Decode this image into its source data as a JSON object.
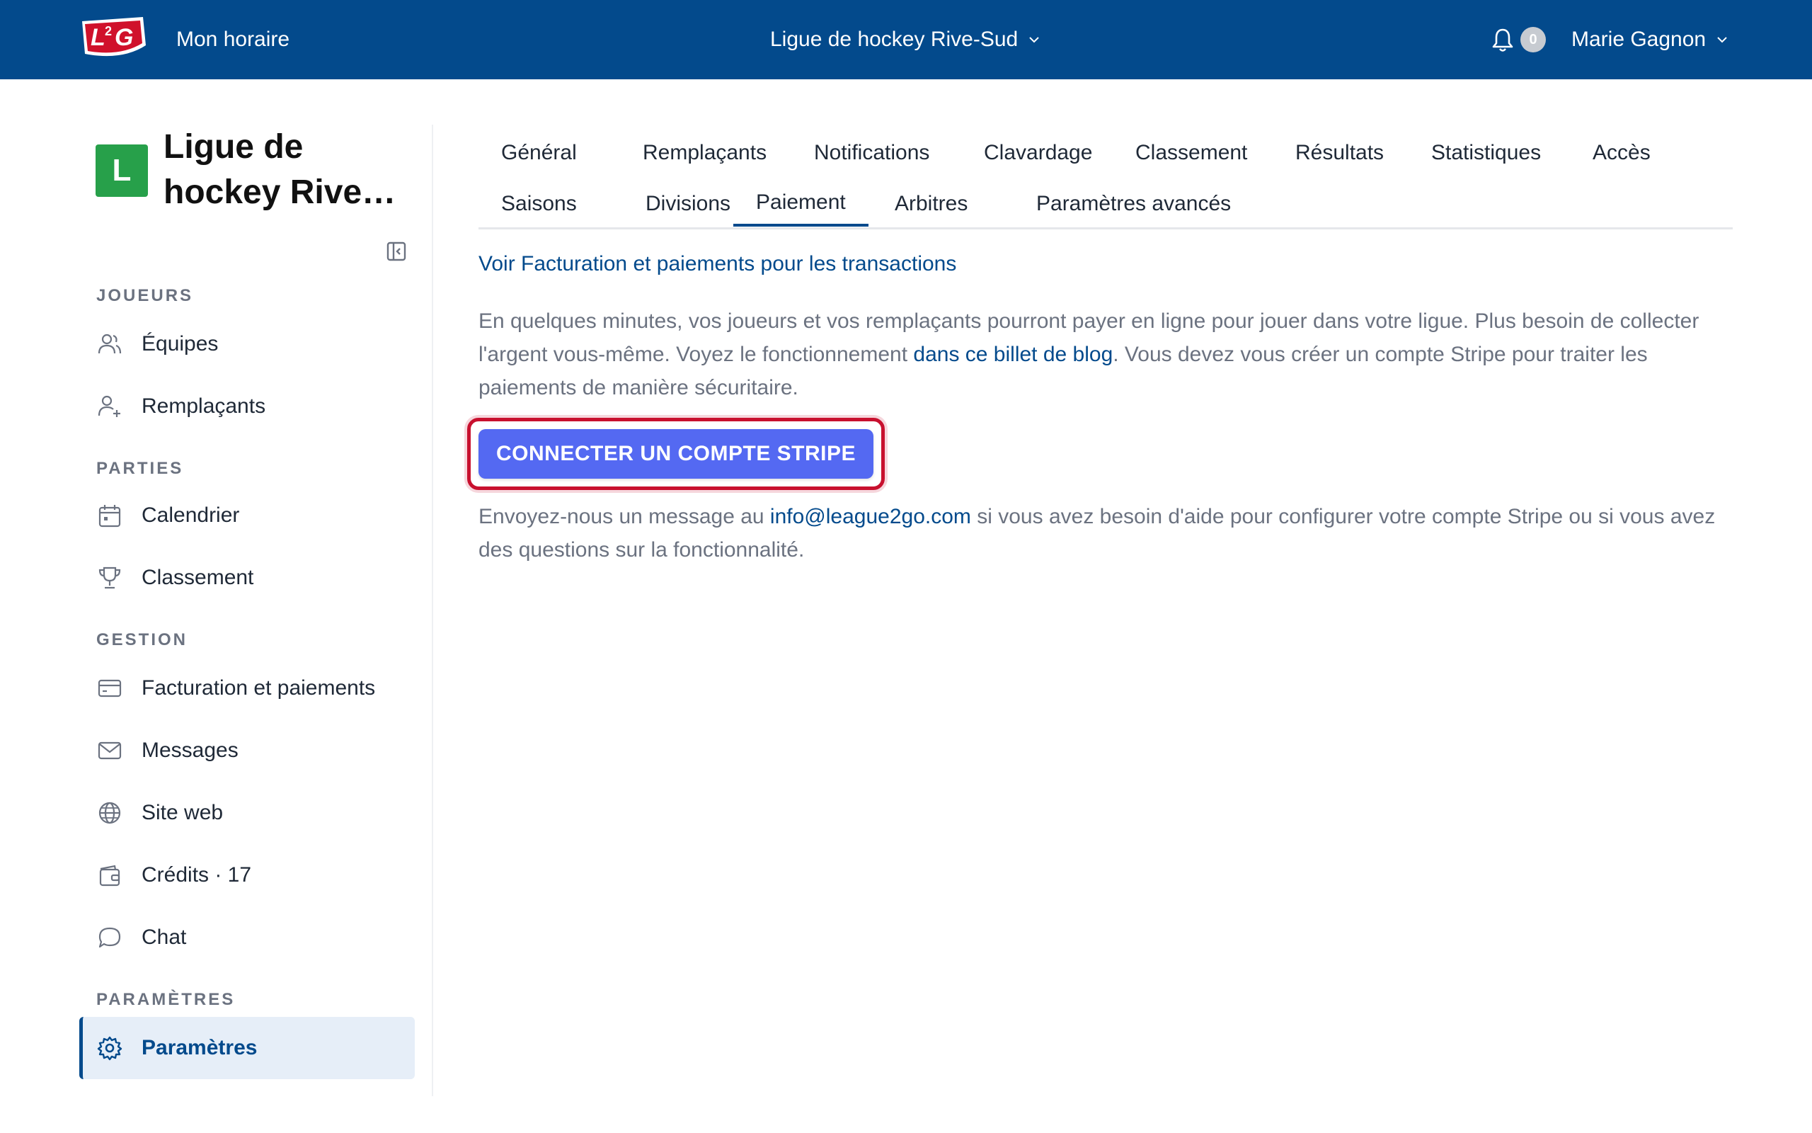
{
  "header": {
    "logo_text": "L2G",
    "nav_link": "Mon horaire",
    "league_selector": "Ligue de hockey Rive-Sud",
    "notification_count": "0",
    "user_name": "Marie Gagnon"
  },
  "sidebar": {
    "org_initial": "L",
    "org_name": "Ligue de hockey Rive-Sud",
    "sections": {
      "players": "JOUEURS",
      "games": "PARTIES",
      "management": "GESTION",
      "settings": "PARAMÈTRES"
    },
    "items": {
      "teams": "Équipes",
      "substitutes": "Remplaçants",
      "calendar": "Calendrier",
      "standings": "Classement",
      "billing": "Facturation et paiements",
      "messages": "Messages",
      "website": "Site web",
      "credits": "Crédits · 17",
      "chat": "Chat",
      "settings": "Paramètres"
    }
  },
  "tabs": {
    "general": "Général",
    "substitutes": "Remplaçants",
    "notifications": "Notifications",
    "chat": "Clavardage",
    "standings": "Classement",
    "results": "Résultats",
    "statistics": "Statistiques",
    "access": "Accès",
    "seasons": "Saisons",
    "divisions": "Divisions",
    "payment": "Paiement",
    "referees": "Arbitres",
    "advanced": "Paramètres avancés"
  },
  "content": {
    "transactions_link": "Voir Facturation et paiements pour les transactions",
    "intro_part1": "En quelques minutes, vos joueurs et vos remplaçants pourront payer en ligne pour jouer dans votre ligue. Plus besoin de collecter l'argent vous-même. Voyez le fonctionnement ",
    "intro_link": "dans ce billet de blog",
    "intro_part2": ". Vous devez vous créer un compte Stripe pour traiter les paiements de manière sécuritaire.",
    "stripe_button": "CONNECTER UN COMPTE STRIPE",
    "help_part1": "Envoyez-nous un message au ",
    "help_email": "info@league2go.com",
    "help_part2": " si vous avez besoin d'aide pour configurer votre compte Stripe ou si vous avez des questions sur la fonctionnalité."
  },
  "colors": {
    "header_bg": "#034a8c",
    "stripe_button": "#5469f2",
    "highlight": "#c8102e",
    "avatar": "#27a04a"
  }
}
